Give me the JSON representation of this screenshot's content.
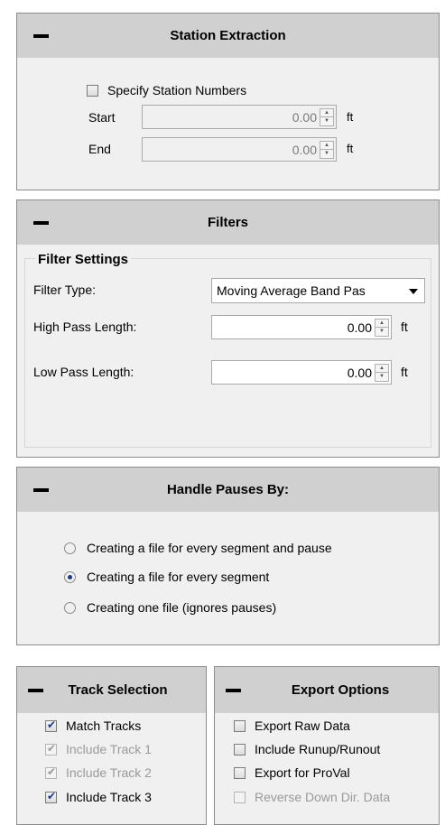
{
  "station_extraction": {
    "title": "Station Extraction",
    "specify_label": "Specify Station Numbers",
    "specify_checked": false,
    "start_label": "Start",
    "start_value": "0.00",
    "end_label": "End",
    "end_value": "0.00",
    "unit": "ft"
  },
  "filters": {
    "title": "Filters",
    "group_title": "Filter Settings",
    "filter_type_label": "Filter Type:",
    "filter_type_value": "Moving Average Band Pas",
    "high_pass_label": "High Pass Length:",
    "high_pass_value": "0.00",
    "low_pass_label": "Low Pass Length:",
    "low_pass_value": "0.00",
    "unit": "ft"
  },
  "pauses": {
    "title": "Handle Pauses By:",
    "options": [
      "Creating a file for every segment and pause",
      "Creating a file for every segment",
      "Creating one file (ignores pauses)"
    ],
    "selected_index": 1
  },
  "track_selection": {
    "title": "Track Selection",
    "items": [
      {
        "label": "Match Tracks",
        "checked": true,
        "enabled": true
      },
      {
        "label": "Include Track 1",
        "checked": true,
        "enabled": false
      },
      {
        "label": "Include Track 2",
        "checked": true,
        "enabled": false
      },
      {
        "label": "Include Track 3",
        "checked": true,
        "enabled": true
      }
    ]
  },
  "export_options": {
    "title": "Export Options",
    "items": [
      {
        "label": "Export Raw Data",
        "checked": false,
        "enabled": true
      },
      {
        "label": "Include Runup/Runout",
        "checked": false,
        "enabled": true
      },
      {
        "label": "Export for ProVal",
        "checked": false,
        "enabled": true
      },
      {
        "label": "Reverse Down Dir. Data",
        "checked": false,
        "enabled": false
      }
    ]
  }
}
